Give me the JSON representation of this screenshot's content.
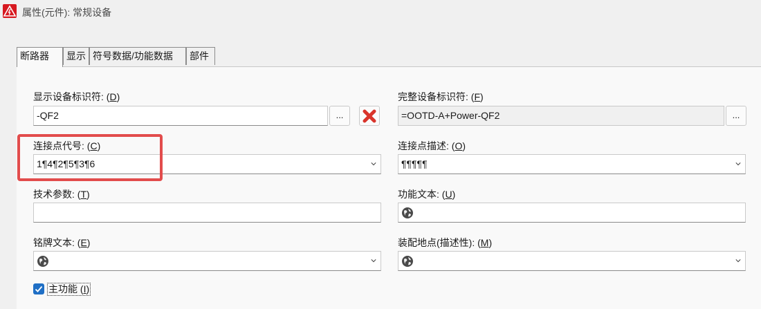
{
  "window": {
    "title": "属性(元件): 常规设备",
    "icon": "eplan-warning-icon"
  },
  "tabs": [
    {
      "label": "断路器",
      "active": true
    },
    {
      "label": "显示",
      "active": false
    },
    {
      "label": "符号数据/功能数据",
      "active": false
    },
    {
      "label": "部件",
      "active": false
    }
  ],
  "fields": {
    "display_id": {
      "label": "显示设备标识符: ",
      "hotkey": "D",
      "value": "-QF2",
      "more": "..."
    },
    "full_id": {
      "label": "完整设备标识符: ",
      "hotkey": "F",
      "value": "=OOTD-A+Power-QF2",
      "more": "..."
    },
    "conn_code": {
      "label": "连接点代号: ",
      "hotkey": "C",
      "value": "1¶4¶2¶5¶3¶6"
    },
    "conn_desc": {
      "label": "连接点描述: ",
      "hotkey": "O",
      "value": "¶¶¶¶¶"
    },
    "tech_param": {
      "label": "技术参数: ",
      "hotkey": "T",
      "value": ""
    },
    "func_text": {
      "label": "功能文本: ",
      "hotkey": "U",
      "value": ""
    },
    "nameplate": {
      "label": "铭牌文本: ",
      "hotkey": "E",
      "value": ""
    },
    "mount_loc": {
      "label": "装配地点(描述性): ",
      "hotkey": "M",
      "value": ""
    }
  },
  "main_function": {
    "label": "主功能 (",
    "hotkey": "I",
    "suffix": ")",
    "checked": true
  },
  "colors": {
    "accent": "#1f6fc5",
    "highlight": "#e24c4c",
    "delete": "#d9342b"
  }
}
